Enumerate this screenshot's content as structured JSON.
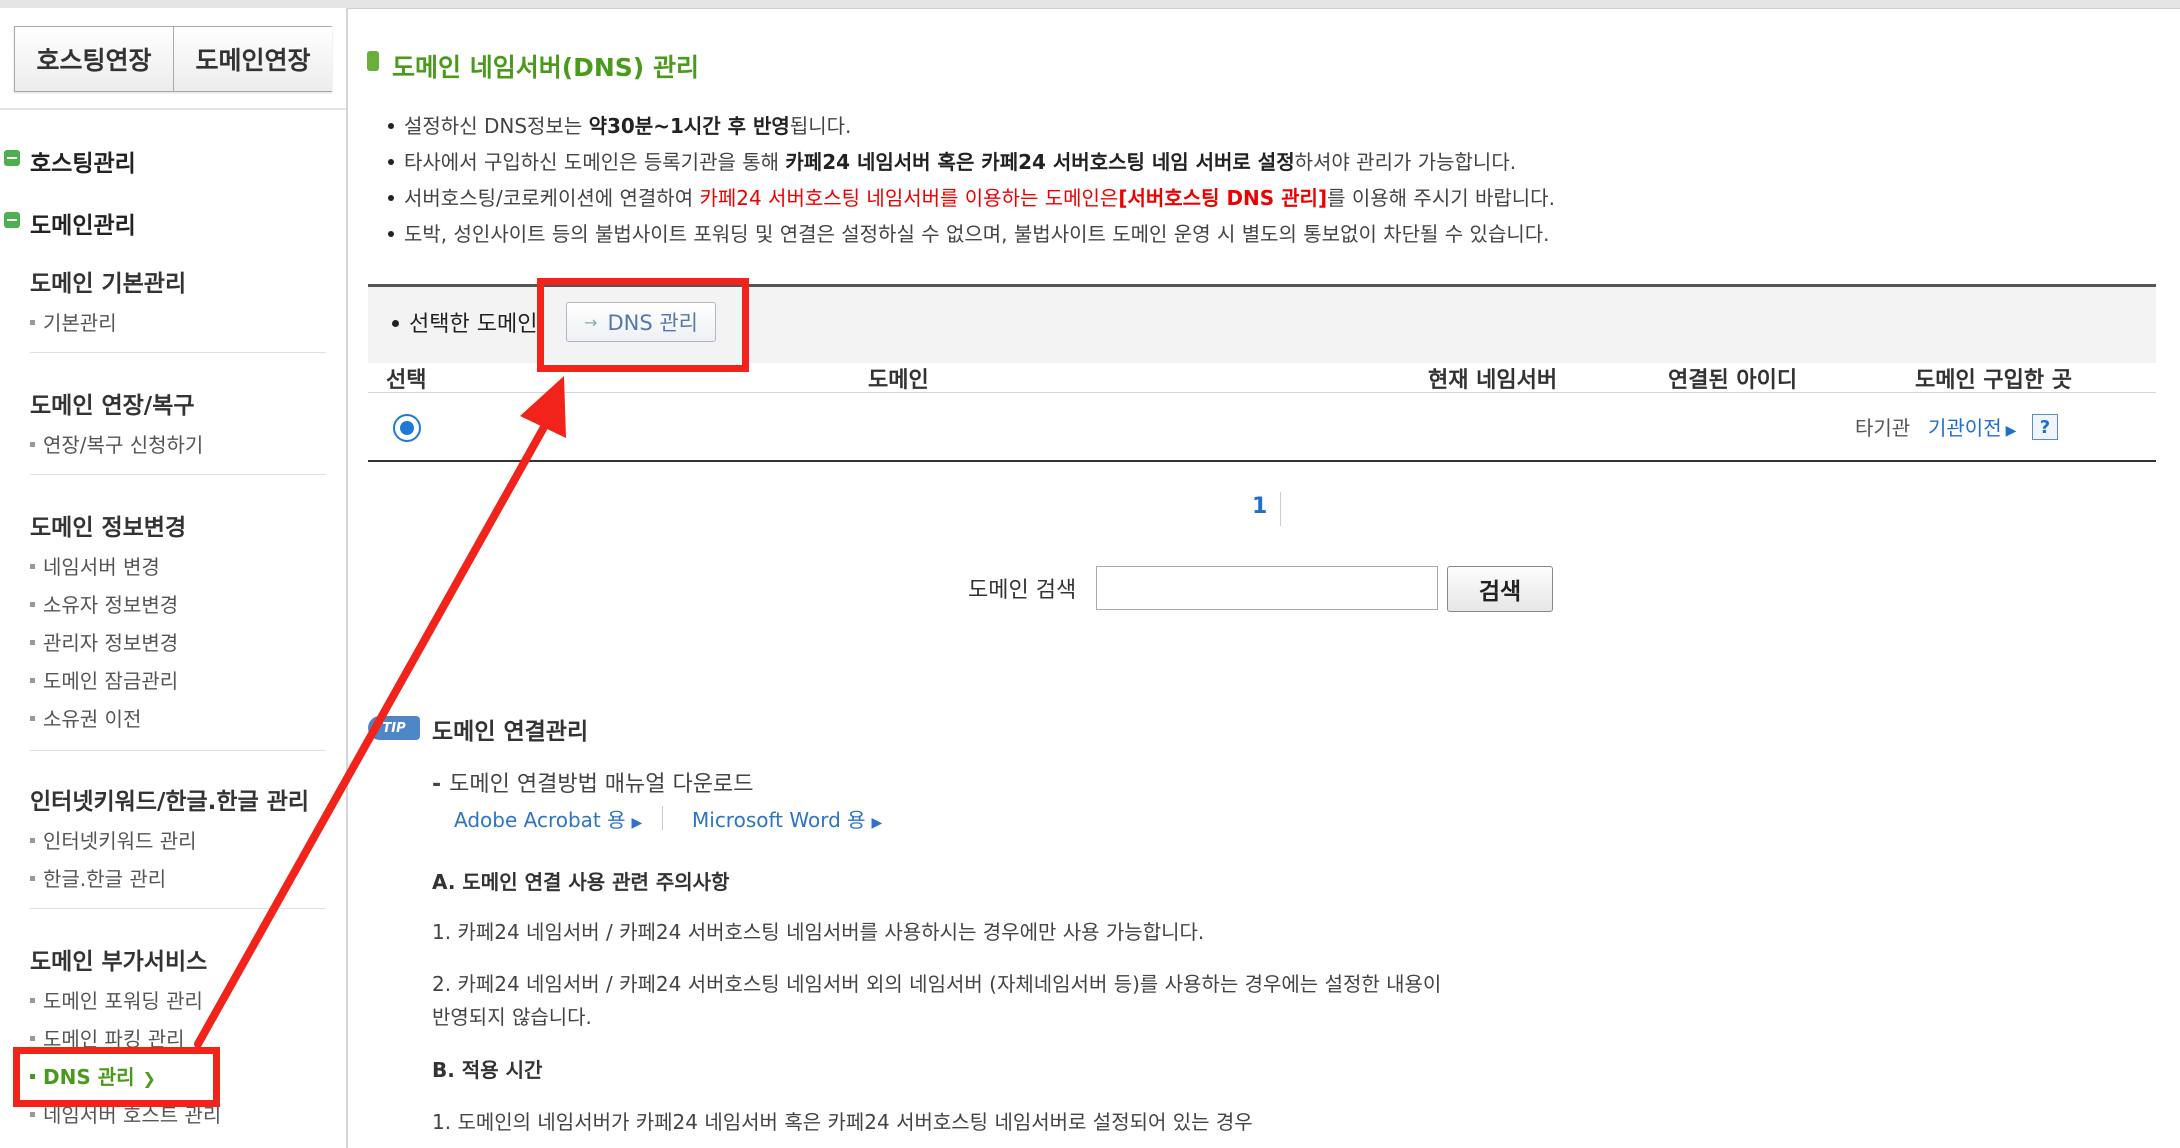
{
  "sidebar": {
    "top_buttons": [
      "호스팅연장",
      "도메인연장"
    ],
    "sections": [
      {
        "title": "호스팅관리"
      },
      {
        "title": "도메인관리"
      }
    ],
    "groups": [
      {
        "title": "도메인 기본관리",
        "items": [
          "기본관리"
        ]
      },
      {
        "title": "도메인 연장/복구",
        "items": [
          "연장/복구 신청하기"
        ]
      },
      {
        "title": "도메인 정보변경",
        "items": [
          "네임서버 변경",
          "소유자 정보변경",
          "관리자 정보변경",
          "도메인 잠금관리",
          "소유권 이전"
        ]
      },
      {
        "title": "인터넷키워드/한글.한글 관리",
        "items": [
          "인터넷키워드 관리",
          "한글.한글 관리"
        ]
      },
      {
        "title": "도메인 부가서비스",
        "items": [
          "도메인 포워딩 관리",
          "도메인 파킹 관리",
          "DNS 관리",
          "네임서버 호스트 관리"
        ]
      }
    ],
    "active_item": "DNS 관리"
  },
  "main": {
    "title": "도메인 네임서버(DNS) 관리",
    "notes": [
      {
        "pre": "설정하신 DNS정보는 ",
        "bold": "약30분~1시간 후 반영",
        "post": "됩니다."
      },
      {
        "pre": "타사에서 구입하신 도메인은 등록기관을 통해 ",
        "bold": "카페24 네임서버 혹은 카페24 서버호스팅 네임 서버로 설정",
        "post": "하셔야 관리가 가능합니다."
      },
      {
        "pre": "서버호스팅/코로케이션에 연결하여 ",
        "red": "카페24 서버호스팅 네임서버를 이용하는 도메인은",
        "redbold": "[서버호스팅 DNS 관리]",
        "post": "를 이용해 주시기 바랍니다."
      },
      {
        "pre": "도박, 성인사이트 등의 불법사이트 포워딩 및 연결은 설정하실 수 없으며, 불법사이트 도메인 운영 시 별도의 통보없이 차단될 수 있습니다."
      }
    ],
    "selected_label": "선택한 도메인",
    "dns_button": "DNS 관리",
    "table": {
      "headers": [
        "선택",
        "도메인",
        "현재 네임서버",
        "연결된 아이디",
        "도메인 구입한 곳"
      ],
      "row": {
        "purchased_at": "타기관",
        "transfer_link": "기관이전",
        "help": "?"
      }
    },
    "pagination": {
      "current": "1"
    },
    "search": {
      "label": "도메인 검색",
      "value": "",
      "button": "검색"
    },
    "tip": {
      "badge": "TIP",
      "title": "도메인 연결관리",
      "manual": "도메인 연결방법 매뉴얼 다운로드",
      "links": [
        "Adobe Acrobat 용",
        "Microsoft Word 용"
      ],
      "a_title": "A. 도메인 연결 사용 관련 주의사항",
      "a1": "1. 카페24 네임서버 / 카페24 서버호스팅 네임서버를 사용하시는 경우에만 사용 가능합니다.",
      "a2_line1": "2. 카페24 네임서버 / 카페24 서버호스팅 네임서버 외의 네임서버 (자체네임서버 등)를 사용하는 경우에는 설정한 내용이",
      "a2_line2": "반영되지 않습니다.",
      "b_title": "B. 적용 시간",
      "b1": "1. 도메인의 네임서버가 카페24 네임서버 혹은 카페24 서버호스팅 네임서버로 설정되어 있는 경우"
    }
  },
  "colors": {
    "accent_green": "#4a9a1c",
    "link_blue": "#1e6fd0",
    "highlight_red": "#f2231b",
    "warning_red": "#e00000"
  }
}
